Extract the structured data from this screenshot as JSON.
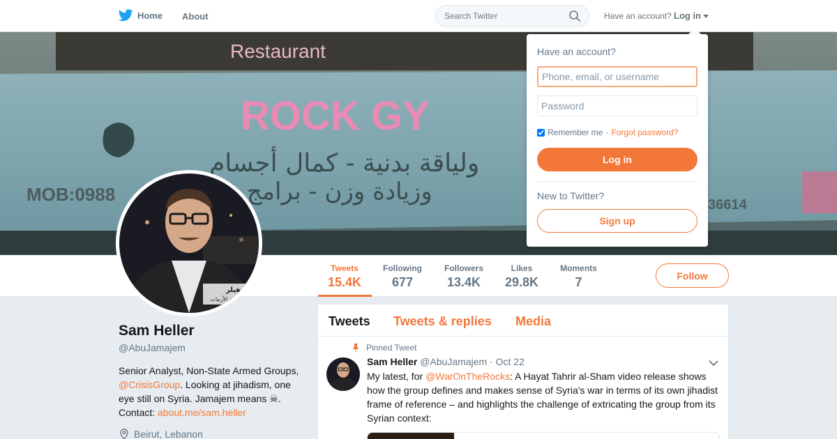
{
  "topnav": {
    "home_label": "Home",
    "about_label": "About",
    "search_placeholder": "Search Twitter",
    "have_account": "Have an account?",
    "login_label": "Log in"
  },
  "banner": {
    "sign_restaurant": "Restaurant",
    "sign_main": "ROCK GY",
    "sign_phone": "MOB:0988",
    "sign_right_num": "36614",
    "sign_arabic_1": "ولياقة بدنية - كمال أجسام",
    "sign_arabic_2": "وزيادة وزن - برامج غذائية"
  },
  "profile": {
    "name": "Sam Heller",
    "handle": "@AbuJamajem",
    "bio_1": "Senior Analyst, Non-State Armed Groups, ",
    "bio_link_1": "@CrisisGroup",
    "bio_2": ". Looking at jihadism, one eye still on Syria. Jamajem means ",
    "bio_emoji": "☠",
    "bio_3": ". Contact: ",
    "bio_link_2": "about.me/sam.heller",
    "location": "Beirut, Lebanon",
    "avatar_caption_1": "م هيلر",
    "avatar_caption_2": "مجموعة الأزمات"
  },
  "stats": [
    {
      "label": "Tweets",
      "value": "15.4K"
    },
    {
      "label": "Following",
      "value": "677"
    },
    {
      "label": "Followers",
      "value": "13.4K"
    },
    {
      "label": "Likes",
      "value": "29.8K"
    },
    {
      "label": "Moments",
      "value": "7"
    }
  ],
  "follow_label": "Follow",
  "timeline": {
    "tabs": [
      "Tweets",
      "Tweets & replies",
      "Media"
    ],
    "pinned_label": "Pinned Tweet",
    "tweet": {
      "name": "Sam Heller",
      "handle": "@AbuJamajem",
      "date": "· Oct 22",
      "text_1": "My latest, for ",
      "text_link": "@WarOnTheRocks",
      "text_2": ": A Hayat Tahrir al-Sham video release shows how the group defines and makes sense of Syria's war in terms of its own jihadist frame of reference – and highlights the challenge of extricating the group from its Syrian context:"
    }
  },
  "login_dropdown": {
    "title": "Have an account?",
    "username_placeholder": "Phone, email, or username",
    "password_placeholder": "Password",
    "remember_label": "Remember me",
    "separator": "·",
    "forgot_label": "Forgot password?",
    "login_button": "Log in",
    "new_label": "New to Twitter?",
    "signup_button": "Sign up"
  },
  "colors": {
    "accent": "#f4773a",
    "twitter_blue": "#1da1f2",
    "text_secondary": "#657786",
    "background": "#e6ecf0"
  },
  "icons": [
    "twitter-bird-icon",
    "search-icon",
    "caret-down-icon",
    "pin-icon",
    "location-icon",
    "chevron-down-icon"
  ]
}
